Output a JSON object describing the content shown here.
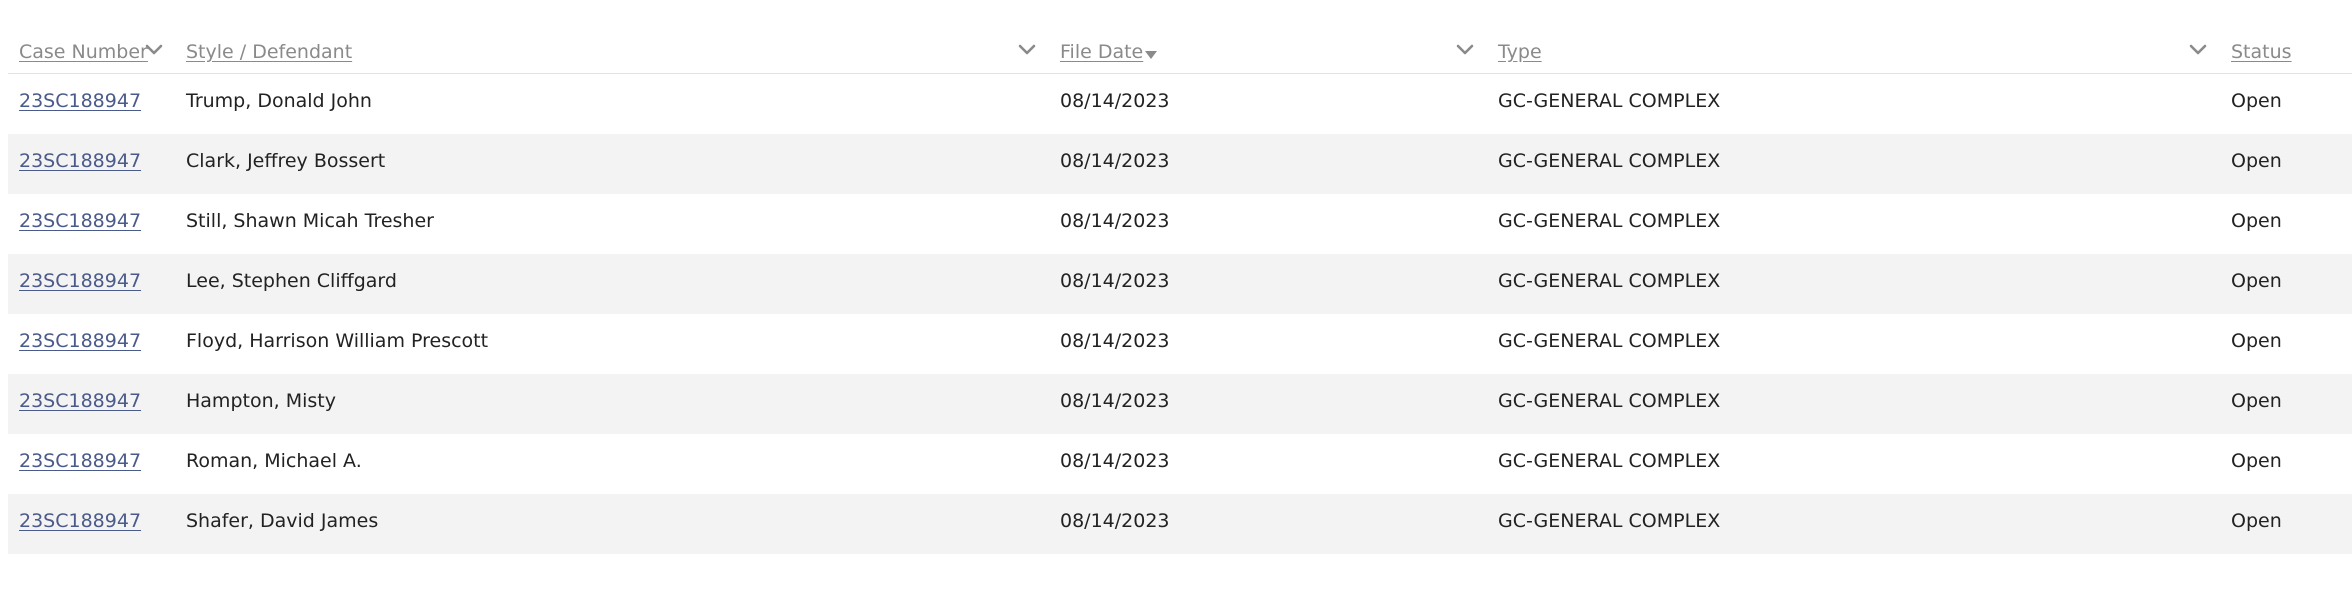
{
  "colors": {
    "header_text": "#8a8a8a",
    "link": "#4a5a8a",
    "body_text": "#222222",
    "alt_row_bg": "#f3f3f3"
  },
  "columns": {
    "case_number": "Case Number",
    "defendant": "Style / Defendant",
    "file_date": "File Date",
    "type": "Type",
    "status": "Status"
  },
  "icons": {
    "case_number_menu": "chevron-down-icon",
    "defendant_menu": "chevron-down-icon",
    "file_date_sort": "sort-descending-icon",
    "file_date_menu": "chevron-down-icon",
    "type_menu": "chevron-down-icon"
  },
  "rows": [
    {
      "case_number": "23SC188947",
      "defendant": "Trump, Donald John",
      "file_date": "08/14/2023",
      "type": "GC-GENERAL COMPLEX",
      "status": "Open"
    },
    {
      "case_number": "23SC188947",
      "defendant": "Clark, Jeffrey Bossert",
      "file_date": "08/14/2023",
      "type": "GC-GENERAL COMPLEX",
      "status": "Open"
    },
    {
      "case_number": "23SC188947",
      "defendant": "Still, Shawn Micah Tresher",
      "file_date": "08/14/2023",
      "type": "GC-GENERAL COMPLEX",
      "status": "Open"
    },
    {
      "case_number": "23SC188947",
      "defendant": "Lee, Stephen Cliffgard",
      "file_date": "08/14/2023",
      "type": "GC-GENERAL COMPLEX",
      "status": "Open"
    },
    {
      "case_number": "23SC188947",
      "defendant": "Floyd, Harrison William Prescott",
      "file_date": "08/14/2023",
      "type": "GC-GENERAL COMPLEX",
      "status": "Open"
    },
    {
      "case_number": "23SC188947",
      "defendant": "Hampton, Misty",
      "file_date": "08/14/2023",
      "type": "GC-GENERAL COMPLEX",
      "status": "Open"
    },
    {
      "case_number": "23SC188947",
      "defendant": "Roman, Michael A.",
      "file_date": "08/14/2023",
      "type": "GC-GENERAL COMPLEX",
      "status": "Open"
    },
    {
      "case_number": "23SC188947",
      "defendant": "Shafer, David James",
      "file_date": "08/14/2023",
      "type": "GC-GENERAL COMPLEX",
      "status": "Open"
    }
  ]
}
